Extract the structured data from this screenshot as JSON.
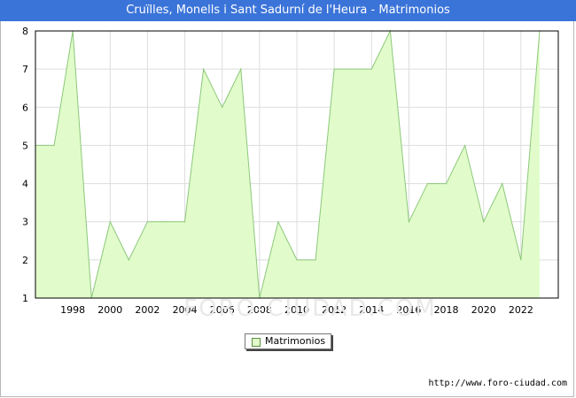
{
  "header": {
    "title": "Cruïlles, Monells i Sant Sadurní de l'Heura - Matrimonios"
  },
  "watermark": "FORO-CIUDAD.COM",
  "source_url": "http://www.foro-ciudad.com",
  "colors": {
    "fill": "#e1fcca",
    "line": "#8cc87a",
    "grid": "#dddddd",
    "header": "#3b74d9"
  },
  "chart_data": {
    "type": "area",
    "title": "Cruïlles, Monells i Sant Sadurní de l'Heura - Matrimonios",
    "xlabel": "",
    "ylabel": "",
    "x": [
      1996,
      1997,
      1998,
      1999,
      2000,
      2001,
      2002,
      2003,
      2004,
      2005,
      2006,
      2007,
      2008,
      2009,
      2010,
      2011,
      2012,
      2013,
      2014,
      2015,
      2016,
      2017,
      2018,
      2019,
      2020,
      2021,
      2022,
      2023
    ],
    "series": [
      {
        "name": "Matrimonios",
        "values": [
          5,
          5,
          8,
          1,
          3,
          2,
          3,
          3,
          3,
          7,
          6,
          7,
          1,
          3,
          2,
          2,
          7,
          7,
          7,
          8,
          3,
          4,
          4,
          5,
          3,
          4,
          2,
          8
        ]
      }
    ],
    "xticks": [
      "1998",
      "2000",
      "2002",
      "2004",
      "2006",
      "2008",
      "2010",
      "2012",
      "2014",
      "2016",
      "2018",
      "2020",
      "2022"
    ],
    "yticks": [
      "1",
      "2",
      "3",
      "4",
      "5",
      "6",
      "7",
      "8"
    ],
    "xlim": [
      1996,
      2024
    ],
    "ylim": [
      1,
      8
    ],
    "grid": true,
    "legend": {
      "position": "bottom-center",
      "label": "Matrimonios"
    }
  }
}
